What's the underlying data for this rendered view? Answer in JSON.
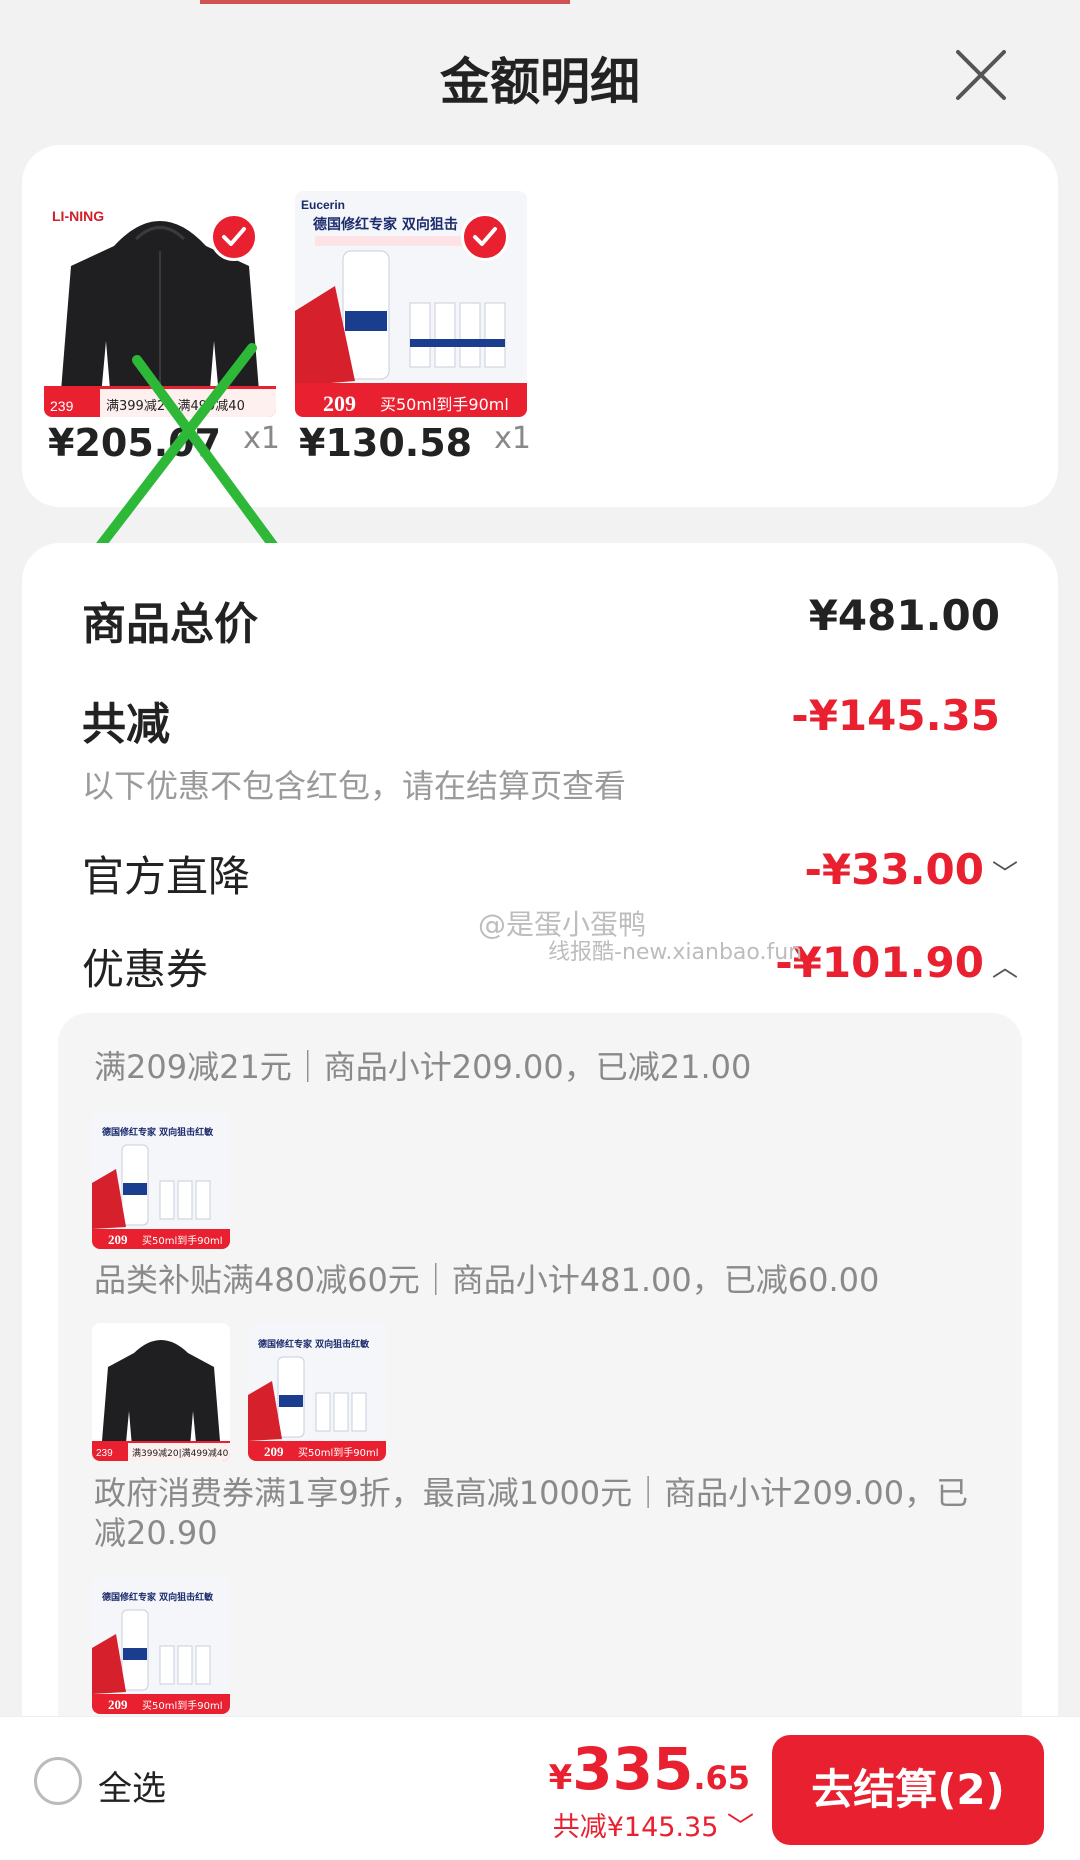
{
  "header": {
    "title": "金额明细"
  },
  "goods": [
    {
      "price": "¥205.07",
      "qty": "x1"
    },
    {
      "price": "¥130.58",
      "qty": "x1"
    }
  ],
  "summary": {
    "total_label": "商品总价",
    "total_value": "¥481.00",
    "reduce_label": "共减",
    "reduce_value": "-¥145.35",
    "note": "以下优惠不包含红包，请在结算页查看",
    "official_label": "官方直降",
    "official_value": "-¥33.00",
    "coupon_label": "优惠券",
    "coupon_value": "-¥101.90"
  },
  "watermark": {
    "line1": "@是蛋小蛋鸭",
    "line2": "线报酷-new.xianbao.fun"
  },
  "coupons": [
    {
      "text": "满209减21元｜商品小计209.00，已减21.00"
    },
    {
      "text": "品类补贴满480减60元｜商品小计481.00，已减60.00"
    },
    {
      "text": "政府消费券满1享9折，最高减1000元｜商品小计209.00，已减20.90"
    }
  ],
  "bottom": {
    "select_all": "全选",
    "currency": "¥",
    "total_int": "335",
    "total_dec": ".65",
    "saved": "共减¥145.35",
    "checkout": "去结算(2)"
  },
  "colors": {
    "accent": "#e8202f",
    "annotation": "#2db838"
  }
}
